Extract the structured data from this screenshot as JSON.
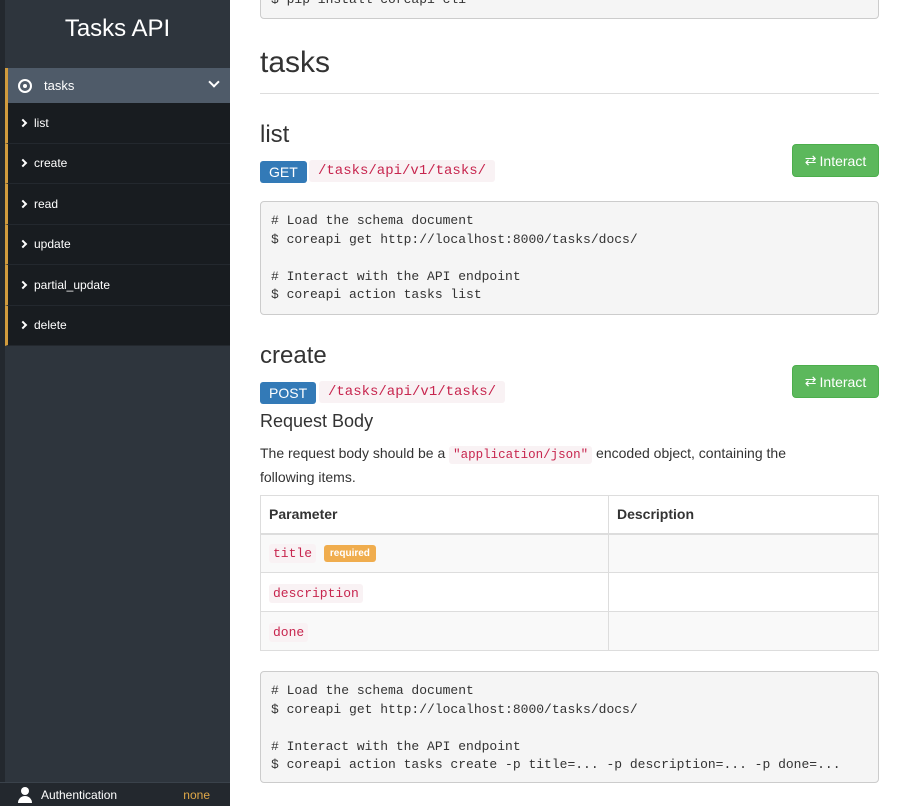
{
  "sidebar": {
    "brand": "Tasks API",
    "group": {
      "label": "tasks"
    },
    "items": [
      {
        "label": "list"
      },
      {
        "label": "create"
      },
      {
        "label": "read"
      },
      {
        "label": "update"
      },
      {
        "label": "partial_update"
      },
      {
        "label": "delete"
      }
    ],
    "auth": {
      "label": "Authentication",
      "status": "none"
    }
  },
  "main": {
    "top_code": "$ pip install coreapi-cli",
    "section_title": "tasks",
    "endpoints": [
      {
        "title": "list",
        "method": "GET",
        "path": "/tasks/api/v1/tasks/",
        "interact_label": "Interact",
        "code": "# Load the schema document\n$ coreapi get http://localhost:8000/tasks/docs/\n\n# Interact with the API endpoint\n$ coreapi action tasks list"
      },
      {
        "title": "create",
        "method": "POST",
        "path": "/tasks/api/v1/tasks/",
        "interact_label": "Interact",
        "request_body_title": "Request Body",
        "request_desc_before": "The request body should be a ",
        "request_desc_code": "\"application/json\"",
        "request_desc_after": " encoded object, containing the following items.",
        "table": {
          "headers": [
            "Parameter",
            "Description"
          ],
          "rows": [
            {
              "param": "title",
              "badge": "required",
              "description": ""
            },
            {
              "param": "description",
              "description": ""
            },
            {
              "param": "done",
              "description": ""
            }
          ]
        },
        "code": "# Load the schema document\n$ coreapi get http://localhost:8000/tasks/docs/\n\n# Interact with the API endpoint\n$ coreapi action tasks create -p title=... -p description=... -p done=..."
      }
    ]
  },
  "colors": {
    "sidebar_bg": "#2e353d",
    "accent": "#d19b3d",
    "method_badge": "#337ab7",
    "interact_button": "#5cb85c",
    "code_color": "#c7254e"
  },
  "icons": {
    "group": "radio-circle-icon",
    "expand": "chevron-down-icon",
    "nav": "chevron-right-icon",
    "interact": "swap-arrows-icon",
    "auth": "user-icon"
  }
}
